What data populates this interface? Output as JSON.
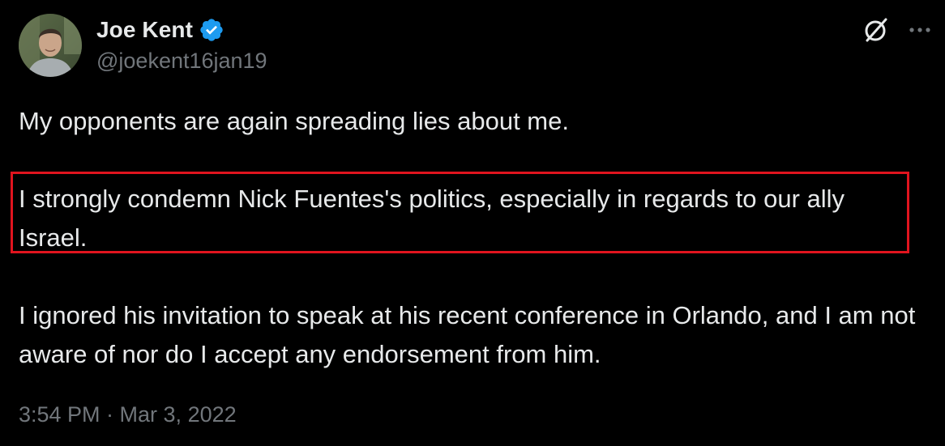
{
  "author": {
    "display_name": "Joe Kent",
    "handle": "@joekent16jan19",
    "verified": true,
    "avatar_icon": "profile-photo"
  },
  "toolbar": {
    "grok_icon": "grok-icon",
    "more_icon": "more-options-icon"
  },
  "tweet": {
    "paragraphs": [
      "My opponents are again spreading lies about me.",
      "I strongly condemn Nick Fuentes's politics, especially in regards to our ally Israel.",
      "I ignored his invitation to speak at his recent conference in Orlando, and I am not aware of nor do I accept any endorsement from him."
    ],
    "timestamp": "3:54 PM · Mar 3, 2022"
  },
  "colors": {
    "background": "#000000",
    "text": "#e7e9ea",
    "secondary_text": "#71767b",
    "verified_badge": "#1d9bf0",
    "highlight_border": "#e0141e"
  }
}
